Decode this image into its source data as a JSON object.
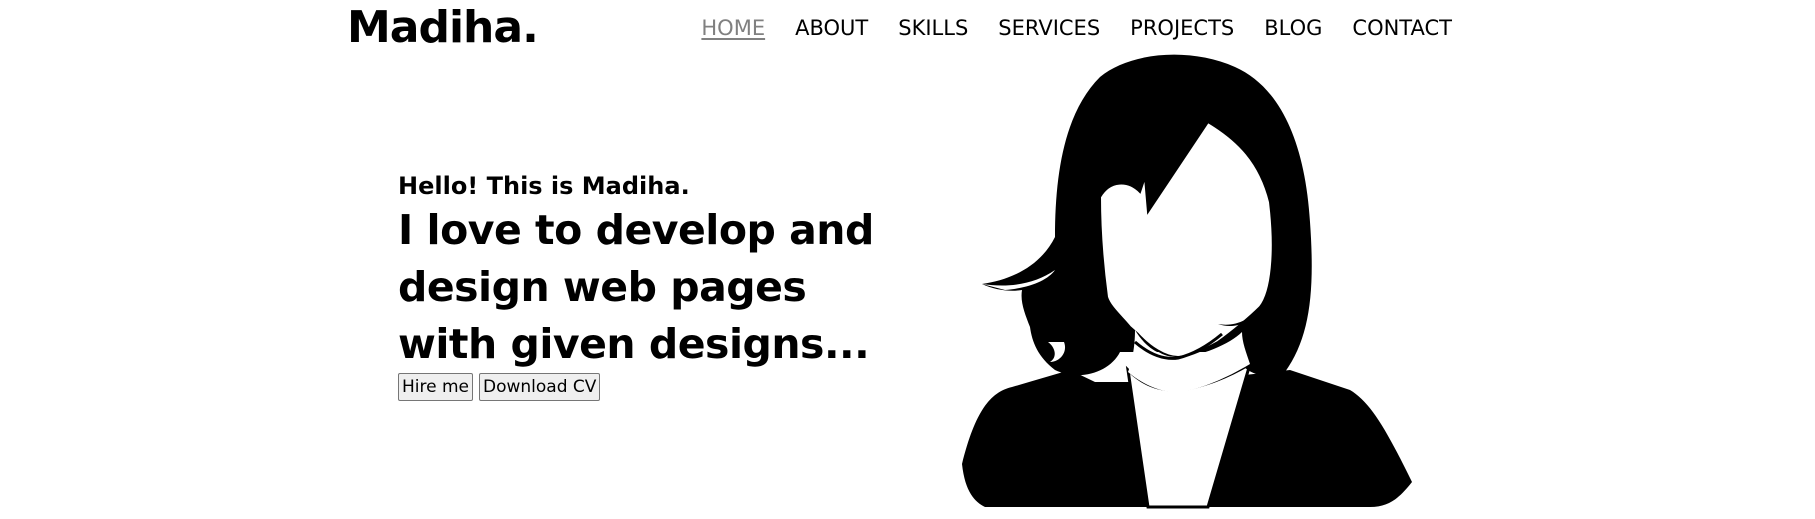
{
  "header": {
    "logo": "Madiha."
  },
  "nav": {
    "items": [
      {
        "label": "HOME",
        "active": true
      },
      {
        "label": "ABOUT",
        "active": false
      },
      {
        "label": "SKILLS",
        "active": false
      },
      {
        "label": "SERVICES",
        "active": false
      },
      {
        "label": "PROJECTS",
        "active": false
      },
      {
        "label": "BLOG",
        "active": false
      },
      {
        "label": "CONTACT",
        "active": false
      }
    ]
  },
  "hero": {
    "greeting": "Hello! This is Madiha.",
    "headline_line1": "I love to develop and",
    "headline_line2": "design web pages",
    "headline_line3": "with given designs...",
    "hire_button": "Hire me",
    "cv_button": "Download CV"
  },
  "illustration": {
    "icon": "woman-avatar-silhouette-icon"
  },
  "colors": {
    "text": "#000000",
    "nav_active": "#808080",
    "background": "#ffffff"
  }
}
